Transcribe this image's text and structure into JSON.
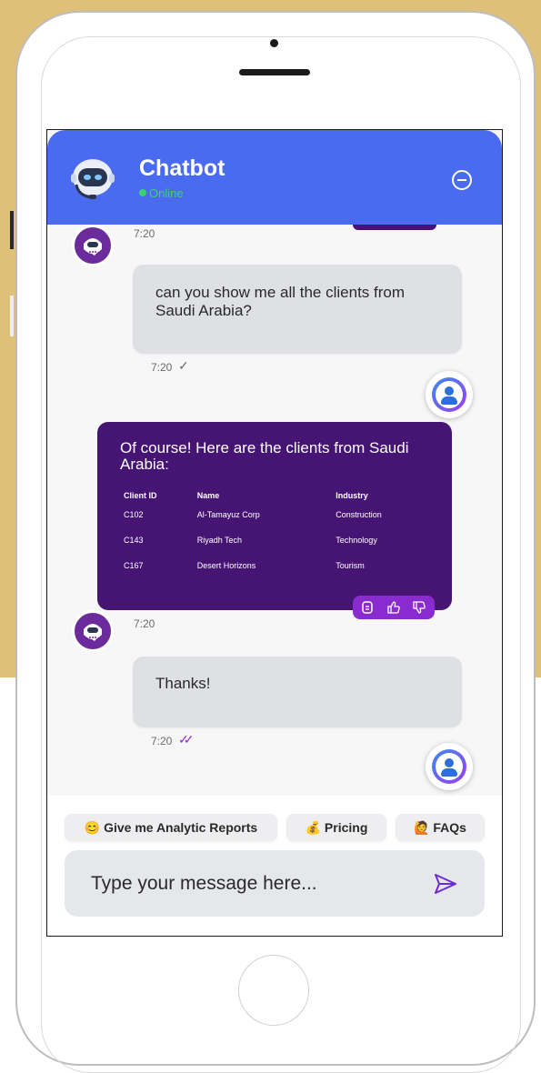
{
  "header": {
    "title": "Chatbot",
    "status": "Online"
  },
  "messages": [
    {
      "role": "bot",
      "time": "7:20"
    },
    {
      "role": "user",
      "text": "can you show me all the clients from Saudi Arabia?",
      "time": "7:20",
      "read": false
    },
    {
      "role": "bot",
      "text": "Of course! Here are the clients from Saudi Arabia:",
      "table": {
        "headers": [
          "Client ID",
          "Name",
          "Industry"
        ],
        "rows": [
          [
            "C102",
            "Al-Tamayuz Corp",
            "Construction"
          ],
          [
            "C143",
            "Riyadh Tech",
            "Technology"
          ],
          [
            "C167",
            "Desert Horizons",
            "Tourism"
          ]
        ]
      },
      "time": "7:20"
    },
    {
      "role": "user",
      "text": "Thanks!",
      "time": "7:20",
      "read": true
    }
  ],
  "quick_replies": [
    "😊 Give me Analytic Reports",
    "💰 Pricing",
    "🙋 FAQs"
  ],
  "input": {
    "placeholder": "Type your message here..."
  },
  "colors": {
    "header": "#4a6bf0",
    "bot_bubble": "#461574",
    "user_bubble": "#dfe0e4",
    "background": "#dfc07a",
    "online": "#39d36b"
  }
}
